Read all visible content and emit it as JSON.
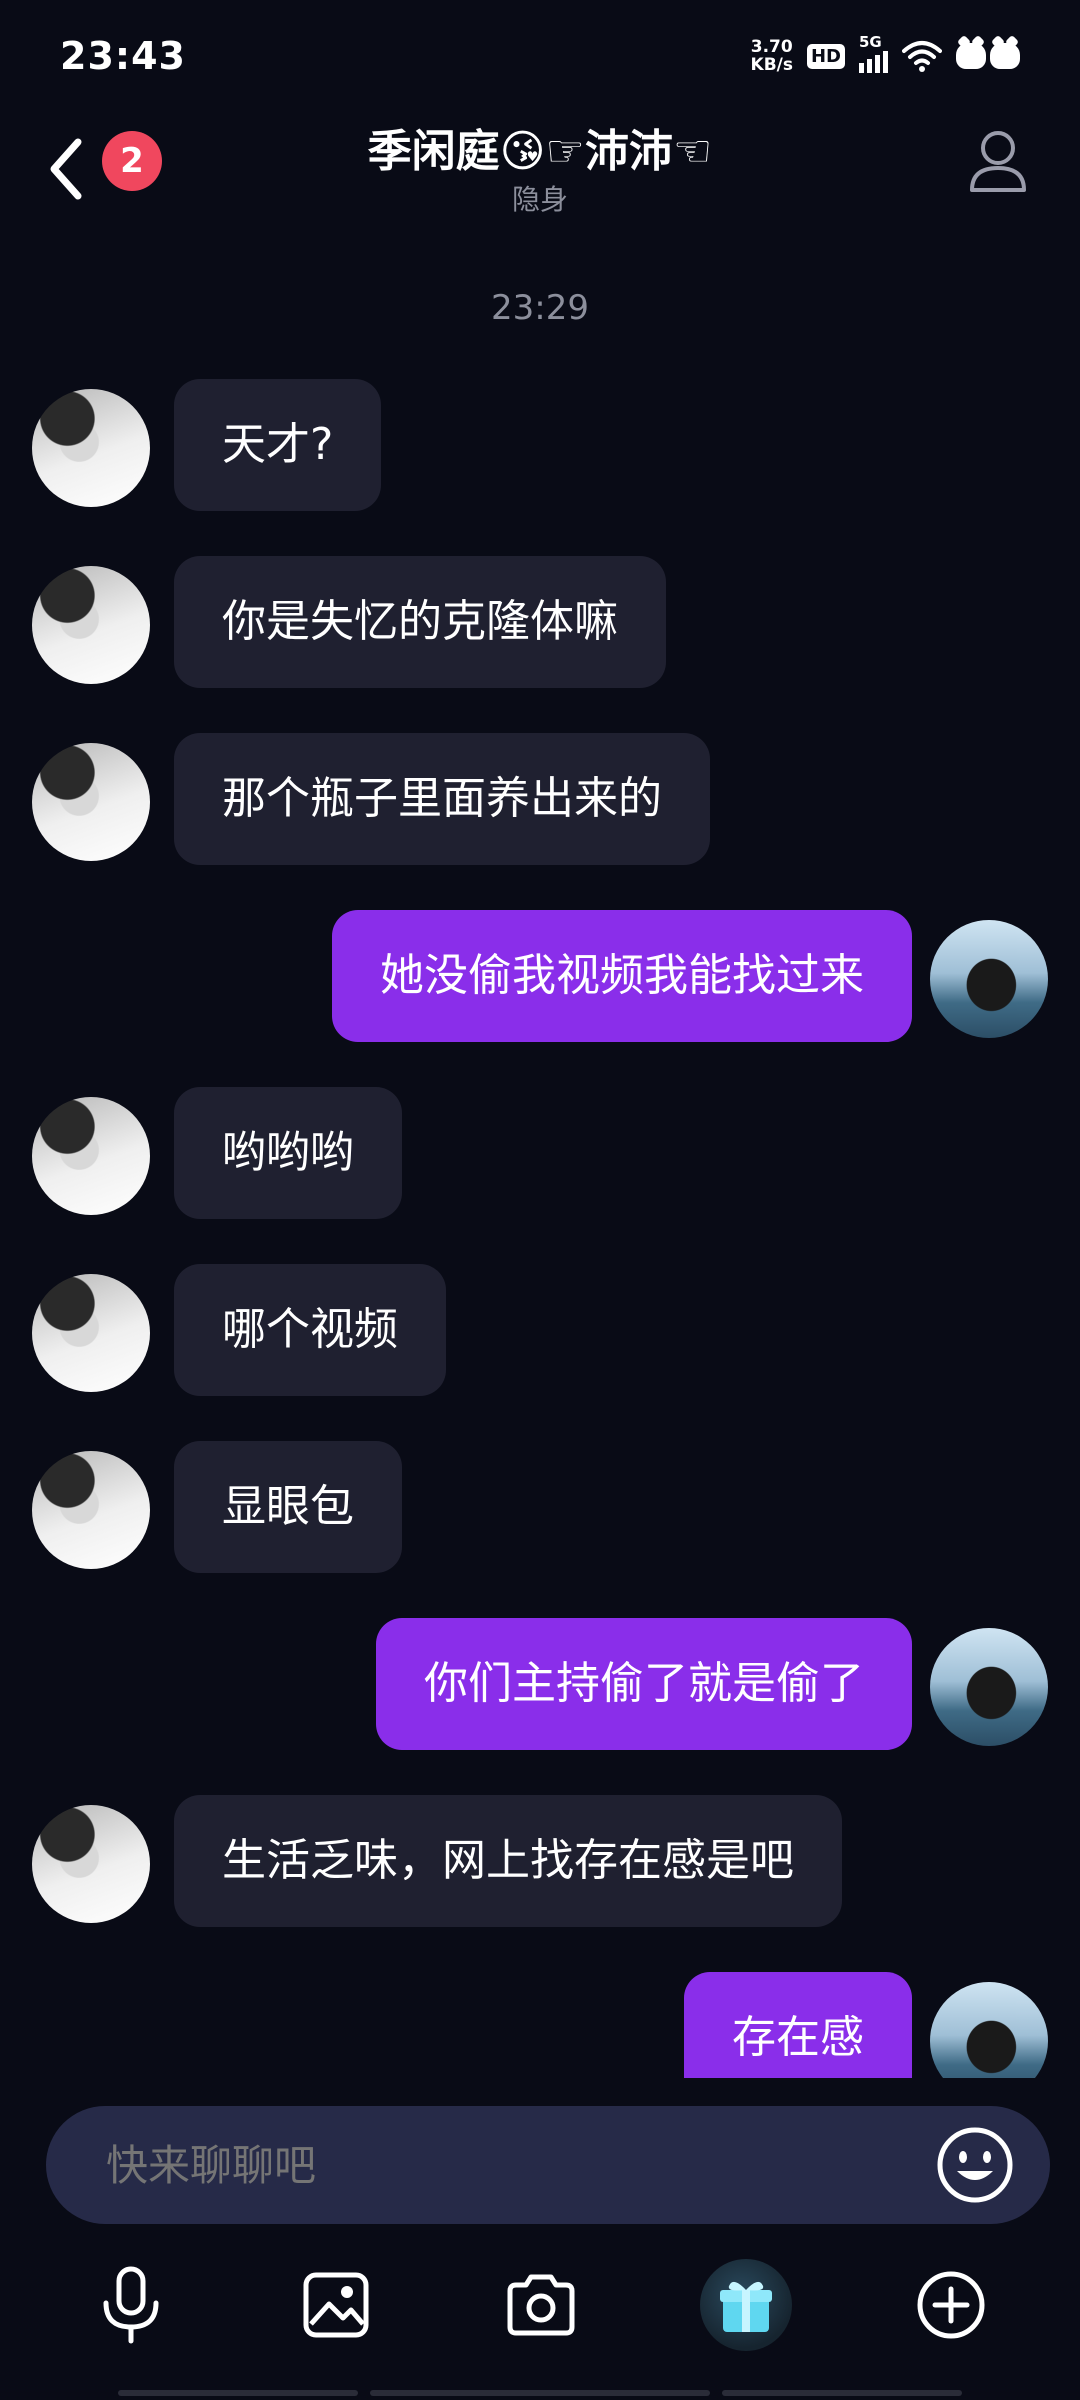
{
  "status_bar": {
    "time": "23:43",
    "net_speed_value": "3.70",
    "net_speed_unit": "KB/s",
    "hd_label": "HD",
    "network_label": "5G",
    "icons": [
      "hd-icon",
      "signal-icon",
      "wifi-icon",
      "cat-sticker-icon"
    ]
  },
  "header": {
    "unread_count": "2",
    "title": "季闲庭😘☞沛沛☜",
    "subtitle": "隐身"
  },
  "chat": {
    "timestamp": "23:29",
    "messages": [
      {
        "sender": "peer",
        "text": "天才?"
      },
      {
        "sender": "peer",
        "text": "你是失忆的克隆体嘛"
      },
      {
        "sender": "peer",
        "text": "那个瓶子里面养出来的"
      },
      {
        "sender": "me",
        "text": "她没偷我视频我能找过来"
      },
      {
        "sender": "peer",
        "text": "哟哟哟"
      },
      {
        "sender": "peer",
        "text": "哪个视频"
      },
      {
        "sender": "peer",
        "text": "显眼包"
      },
      {
        "sender": "me",
        "text": "你们主持偷了就是偷了"
      },
      {
        "sender": "peer",
        "text": "生活乏味，网上找存在感是吧"
      },
      {
        "sender": "me",
        "text": "存在感"
      }
    ]
  },
  "input": {
    "placeholder": "快来聊聊吧"
  },
  "toolbar": {
    "icons": [
      "microphone-icon",
      "image-icon",
      "camera-icon",
      "gift-icon",
      "plus-icon"
    ]
  },
  "colors": {
    "background": "#090b16",
    "peer_bubble": "#1f2030",
    "my_bubble": "#8a2eea",
    "badge": "#f0475e",
    "input_bar": "#262a48"
  }
}
